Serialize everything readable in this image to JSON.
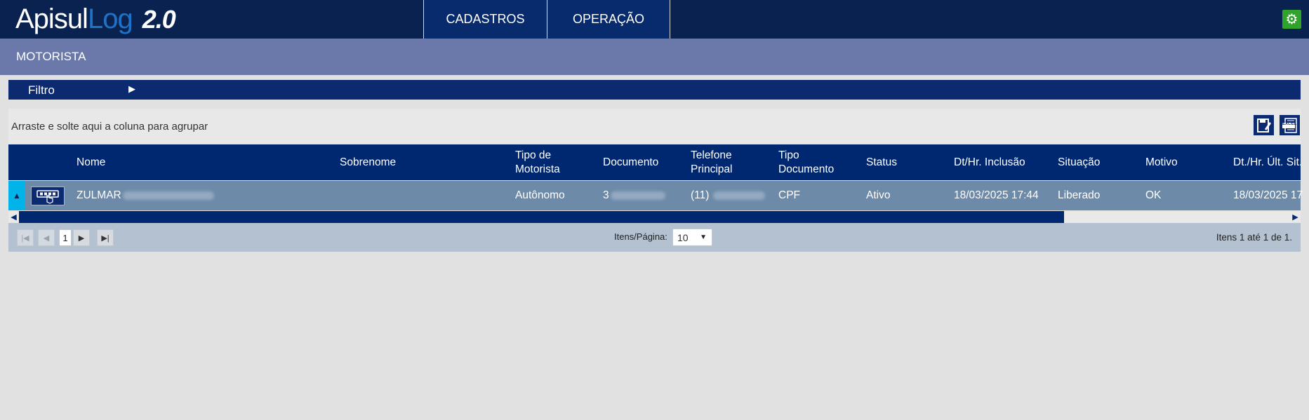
{
  "app": {
    "logo_part1": "Apisul",
    "logo_part2": "Log",
    "logo_version": "2.0"
  },
  "nav": {
    "tabs": [
      {
        "label": "CADASTROS"
      },
      {
        "label": "OPERAÇÃO"
      }
    ],
    "settings_icon": "gear-icon"
  },
  "page": {
    "title": "MOTORISTA"
  },
  "filter": {
    "label": "Filtro",
    "icon": "caret-right-icon"
  },
  "grouping": {
    "hint": "Arraste e solte aqui a coluna para agrupar",
    "save_icon": "save-layout-icon",
    "excel_label": "EXCEL"
  },
  "grid": {
    "columns": [
      {
        "line1": "Nome",
        "line2": ""
      },
      {
        "line1": "Sobrenome",
        "line2": ""
      },
      {
        "line1": "Tipo de",
        "line2": "Motorista"
      },
      {
        "line1": "Documento",
        "line2": ""
      },
      {
        "line1": "Telefone",
        "line2": "Principal"
      },
      {
        "line1": "Tipo",
        "line2": "Documento"
      },
      {
        "line1": "Status",
        "line2": ""
      },
      {
        "line1": "Dt/Hr. Inclusão",
        "line2": ""
      },
      {
        "line1": "Situação",
        "line2": ""
      },
      {
        "line1": "Motivo",
        "line2": ""
      },
      {
        "line1": "Dt./Hr. Últ. Sit.",
        "line2": ""
      }
    ],
    "rows": [
      {
        "nome": "ZULMAR",
        "tipo_motorista": "Autônomo",
        "documento": "3",
        "telefone": "(11)",
        "tipo_documento": "CPF",
        "status": "Ativo",
        "inclusao": "18/03/2025 17:44",
        "situacao": "Liberado",
        "motivo": "OK",
        "ult_sit": "18/03/2025 17"
      }
    ]
  },
  "pager": {
    "current_page": "1",
    "items_per_page_label": "Itens/Página:",
    "items_per_page": "10",
    "info": "Itens 1 até 1 de 1."
  },
  "colors": {
    "header": "#0a2250",
    "accent": "#002870",
    "title_bar": "#6b79aa",
    "row": "#6d8aa8",
    "settings": "#2fa32a"
  }
}
